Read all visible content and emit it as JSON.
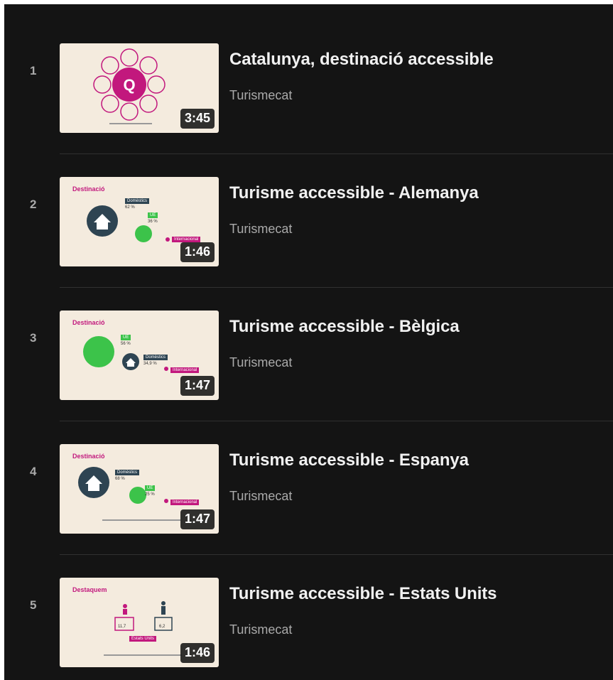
{
  "playlist": {
    "items": [
      {
        "index": "1",
        "title": "Catalunya, destinació accessible",
        "channel": "Turismecat",
        "duration": "3:45"
      },
      {
        "index": "2",
        "title": "Turisme accessible - Alemanya",
        "channel": "Turismecat",
        "duration": "1:46",
        "thumb": {
          "heading": "Destinació",
          "tag1": "Domèstics",
          "val1": "62 %",
          "tag2": "UE",
          "val2": "36 %",
          "tag3": "Internacional"
        }
      },
      {
        "index": "3",
        "title": "Turisme accessible - Bèlgica",
        "channel": "Turismecat",
        "duration": "1:47",
        "thumb": {
          "heading": "Destinació",
          "tag1": "UE",
          "val1": "56 %",
          "tag2": "Domèstics",
          "val2": "34,9 %",
          "tag3": "Internacional"
        }
      },
      {
        "index": "4",
        "title": "Turisme accessible - Espanya",
        "channel": "Turismecat",
        "duration": "1:47",
        "thumb": {
          "heading": "Destinació",
          "tag1": "Domèstics",
          "val1": "68 %",
          "tag2": "UE",
          "val2": "25 %",
          "tag3": "Internacional"
        }
      },
      {
        "index": "5",
        "title": "Turisme accessible - Estats Units",
        "channel": "Turismecat",
        "duration": "1:46",
        "thumb": {
          "heading": "Destaquem",
          "val1": "11,7",
          "val2": "6,2",
          "tag1": "Estats Units"
        }
      }
    ]
  },
  "colors": {
    "background": "#141414",
    "title": "#f1f1f1",
    "secondary": "#aaaaaa",
    "thumb_bg": "#f4ebde",
    "accent_pink": "#c2187d",
    "accent_green": "#3cc34a",
    "dark_slate": "#2e4452"
  }
}
